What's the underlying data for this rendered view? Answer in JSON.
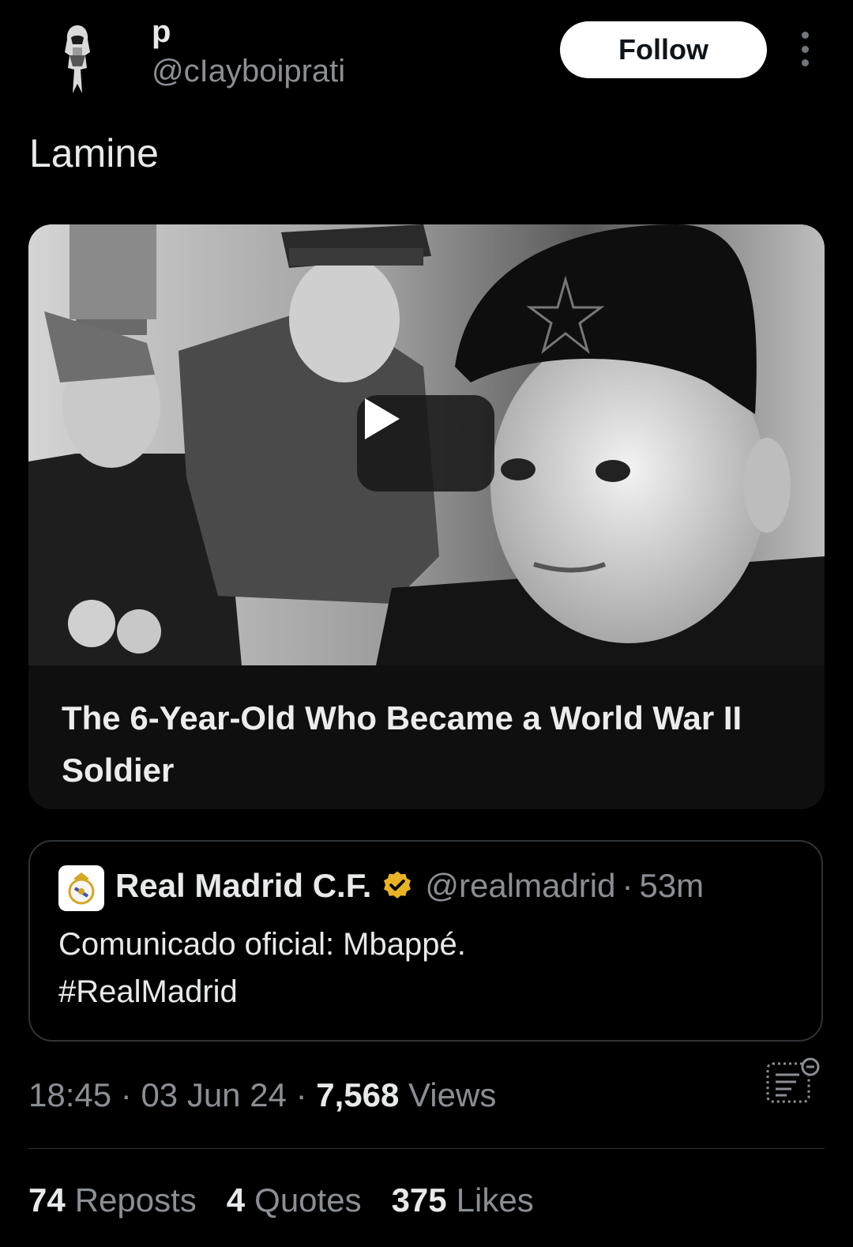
{
  "author": {
    "display_name": "p",
    "handle": "@cIayboiprati",
    "avatar_icon": "hooded-figure-avatar"
  },
  "header": {
    "follow_label": "Follow",
    "more_icon": "vertical-ellipsis-icon"
  },
  "tweet": {
    "text": "Lamine"
  },
  "media": {
    "title": "The 6-Year-Old Who Became a World War II Soldier",
    "play_icon": "play-icon"
  },
  "quoted": {
    "name": "Real Madrid C.F.",
    "verified_icon": "verified-badge-icon",
    "verified_color": "#e8b325",
    "handle": "@realmadrid",
    "separator": "·",
    "time": "53m",
    "text_line1": "Comunicado oficial: Mbappé.",
    "text_line2": "#RealMadrid"
  },
  "meta": {
    "time": "18:45",
    "sep1": " · ",
    "date": "03 Jun 24",
    "sep2": " · ",
    "views_count": "7,568",
    "views_label": "Views"
  },
  "stats": {
    "reposts_count": "74",
    "reposts_label": "Reposts",
    "quotes_count": "4",
    "quotes_label": "Quotes",
    "likes_count": "375",
    "likes_label": "Likes"
  },
  "colors": {
    "background": "#000000",
    "primary_text": "#e7e9ea",
    "secondary_text": "#8b8f94",
    "border": "#2f3336"
  }
}
